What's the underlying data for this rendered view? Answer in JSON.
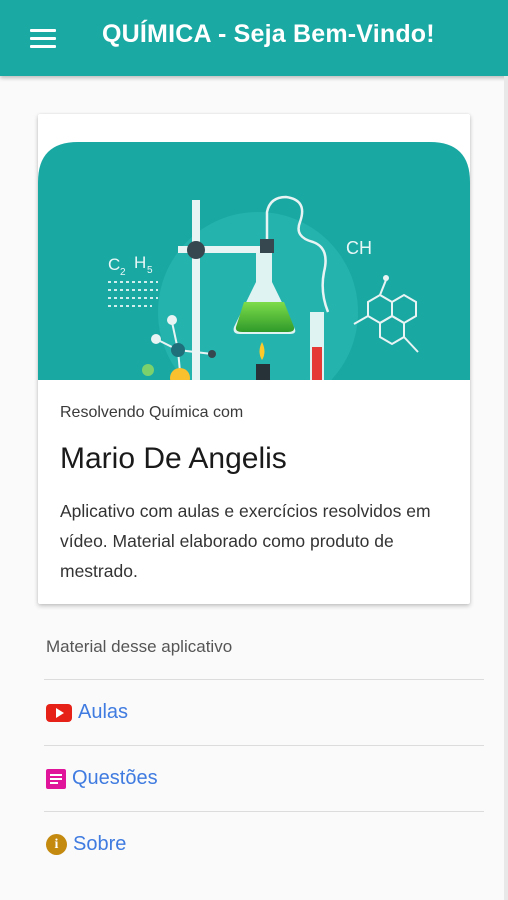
{
  "appbar": {
    "title": "QUÍMICA - Seja Bem-Vindo!",
    "menu_icon": "hamburger-menu-icon"
  },
  "card": {
    "image": {
      "description_icon": "chemistry-lab-illustration",
      "formula_left_c": "C",
      "formula_left_sub1": "2",
      "formula_left_h": "H",
      "formula_left_sub2": "5",
      "formula_right": "CH"
    },
    "subtitle": "Resolvendo Química com",
    "title": "Mario De Angelis",
    "text": "Aplicativo com aulas e exercícios resolvidos em vídeo. Material elaborado como produto de mestrado."
  },
  "section": {
    "label": "Material desse aplicativo"
  },
  "menu": [
    {
      "label": "Aulas",
      "icon": "youtube-icon"
    },
    {
      "label": "Questões",
      "icon": "document-icon"
    },
    {
      "label": "Sobre",
      "icon": "info-icon"
    }
  ],
  "colors": {
    "primary": "#1ba9a4",
    "link": "#3f7be0",
    "youtube": "#e62117",
    "doc": "#e0149a",
    "info": "#c48a10"
  }
}
